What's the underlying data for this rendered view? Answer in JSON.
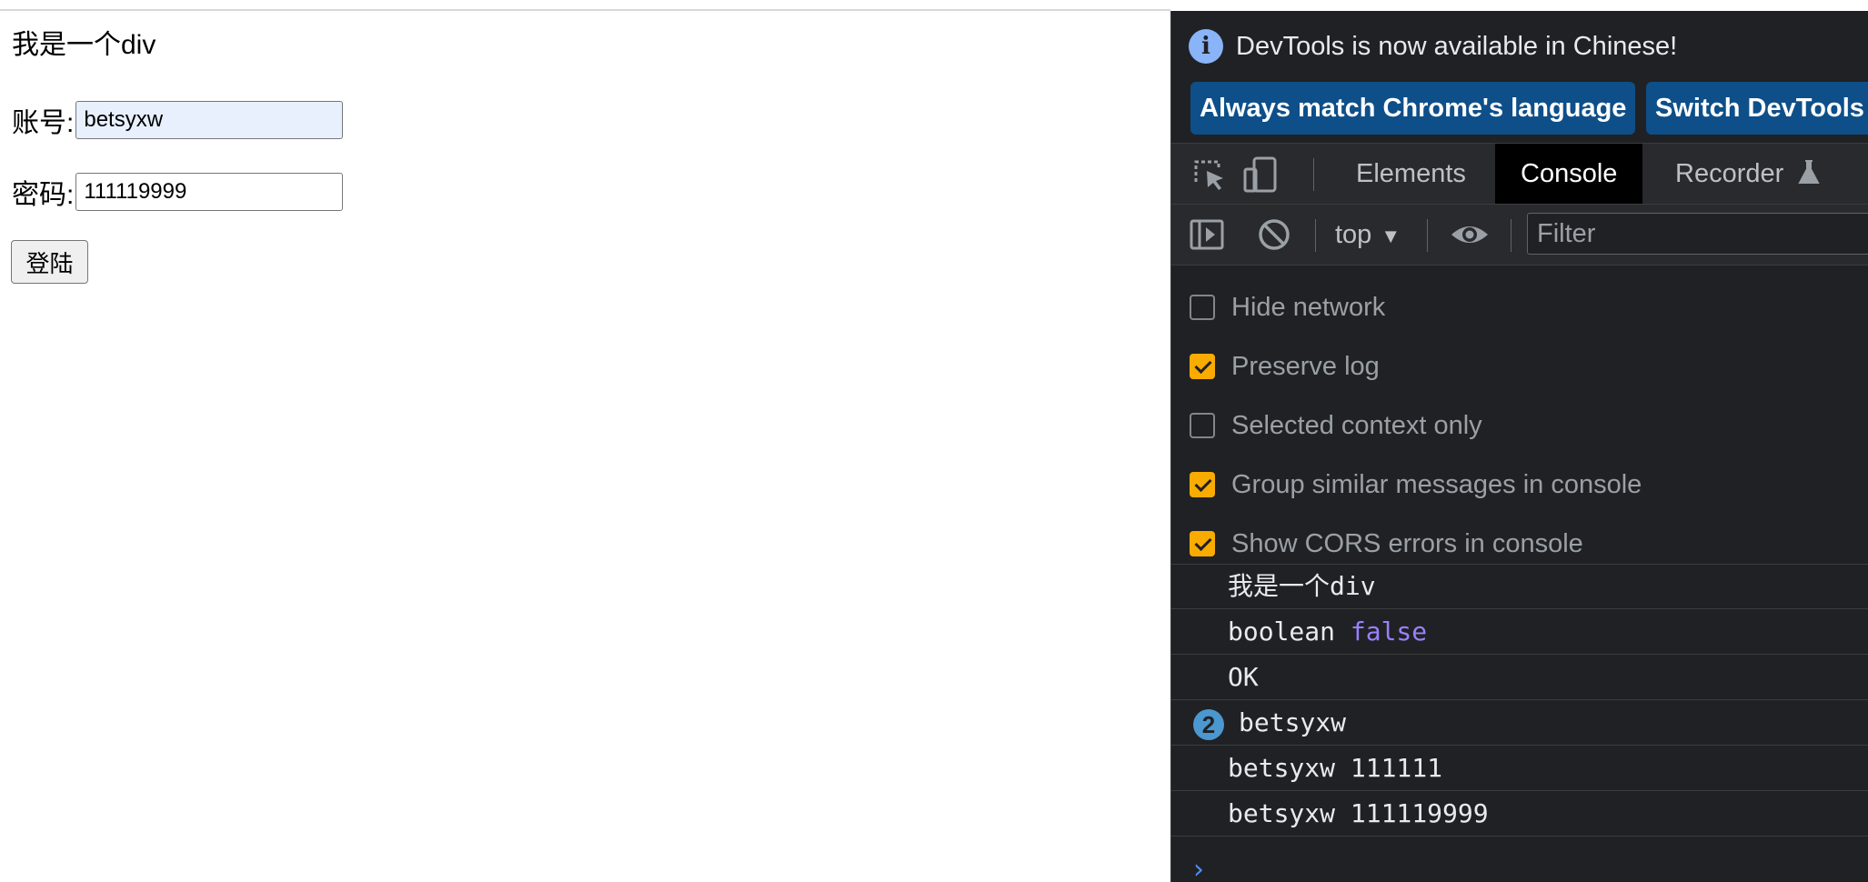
{
  "page": {
    "heading": "我是一个div",
    "account_label": "账号:",
    "account_value": "betsyxw",
    "password_label": "密码:",
    "password_value": "111119999",
    "login_button": "登陆"
  },
  "devtools": {
    "banner": {
      "message": "DevTools is now available in Chinese!",
      "button_match": "Always match Chrome's language",
      "button_switch": "Switch DevTools"
    },
    "tabs": [
      {
        "label": "Elements",
        "active": false
      },
      {
        "label": "Console",
        "active": true
      },
      {
        "label": "Recorder",
        "active": false
      }
    ],
    "toolbar": {
      "context": "top",
      "filter_placeholder": "Filter"
    },
    "settings": [
      {
        "label": "Hide network",
        "checked": false
      },
      {
        "label": "Preserve log",
        "checked": true
      },
      {
        "label": "Selected context only",
        "checked": false
      },
      {
        "label": "Group similar messages in console",
        "checked": true
      },
      {
        "label": "Show CORS errors in console",
        "checked": true
      }
    ],
    "console_messages": [
      {
        "text": "我是一个div"
      },
      {
        "text": "boolean ",
        "keyword": "false"
      },
      {
        "text": "OK"
      },
      {
        "text": "betsyxw",
        "count": "2"
      },
      {
        "text": "betsyxw 111111"
      },
      {
        "text": "betsyxw 111119999"
      }
    ],
    "colors": {
      "accent_blue": "#0e4f89",
      "checkbox_checked": "#f9ab00",
      "keyword_purple": "#9980ff",
      "prompt_blue": "#4c8ef8"
    }
  }
}
